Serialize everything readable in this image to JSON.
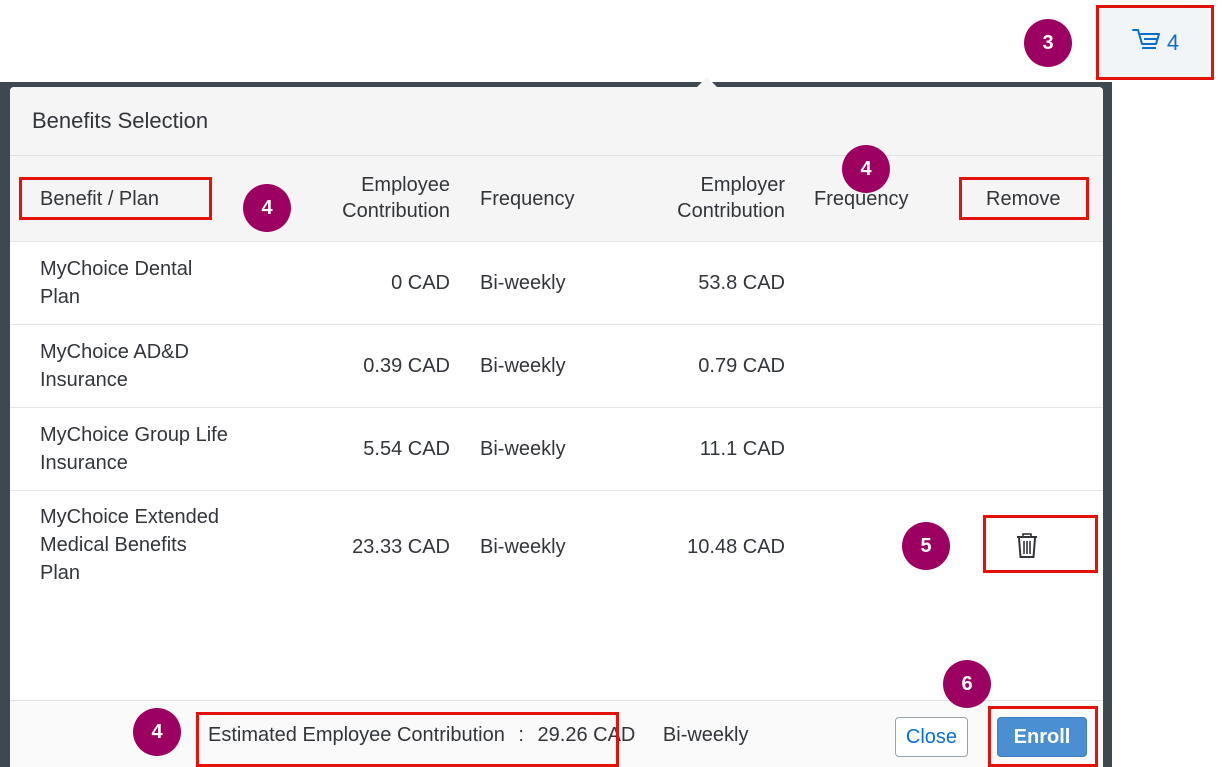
{
  "cart": {
    "count": "4"
  },
  "dialog": {
    "title": "Benefits Selection",
    "columns": {
      "benefit": "Benefit / Plan",
      "employee_contribution_l1": "Employee",
      "employee_contribution_l2": "Contribution",
      "frequency": "Frequency",
      "employer_contribution_l1": "Employer",
      "employer_contribution_l2": "Contribution",
      "frequency2": "Frequency",
      "remove": "Remove"
    },
    "rows": [
      {
        "name_l1": "MyChoice Dental",
        "name_l2": "Plan",
        "name_l3": "",
        "employee": "0 CAD",
        "frequency": "Bi-weekly",
        "employer": "53.8 CAD"
      },
      {
        "name_l1": "MyChoice AD&D",
        "name_l2": "Insurance",
        "name_l3": "",
        "employee": "0.39 CAD",
        "frequency": "Bi-weekly",
        "employer": "0.79 CAD"
      },
      {
        "name_l1": "MyChoice Group Life",
        "name_l2": "Insurance",
        "name_l3": "",
        "employee": "5.54 CAD",
        "frequency": "Bi-weekly",
        "employer": "11.1 CAD"
      },
      {
        "name_l1": "MyChoice Extended",
        "name_l2": "Medical Benefits",
        "name_l3": "Plan",
        "employee": "23.33 CAD",
        "frequency": "Bi-weekly",
        "employer": "10.48 CAD"
      }
    ],
    "footer": {
      "estimate_label": "Estimated Employee Contribution",
      "separator": ":",
      "estimate_value": "29.26 CAD",
      "estimate_frequency": "Bi-weekly",
      "close_label": "Close",
      "enroll_label": "Enroll"
    }
  },
  "annotations": {
    "badge_cart": "3",
    "badge_header_a": "4",
    "badge_header_b": "4",
    "badge_trash": "5",
    "badge_enroll": "6",
    "badge_footer": "4"
  },
  "colors": {
    "annotation_box": "#e3120b",
    "badge": "#9c0060",
    "primary_button": "#4a8fd1",
    "link": "#0a6ed1"
  },
  "icons": {
    "cart": "shopping-cart-icon",
    "trash": "trash-icon"
  }
}
